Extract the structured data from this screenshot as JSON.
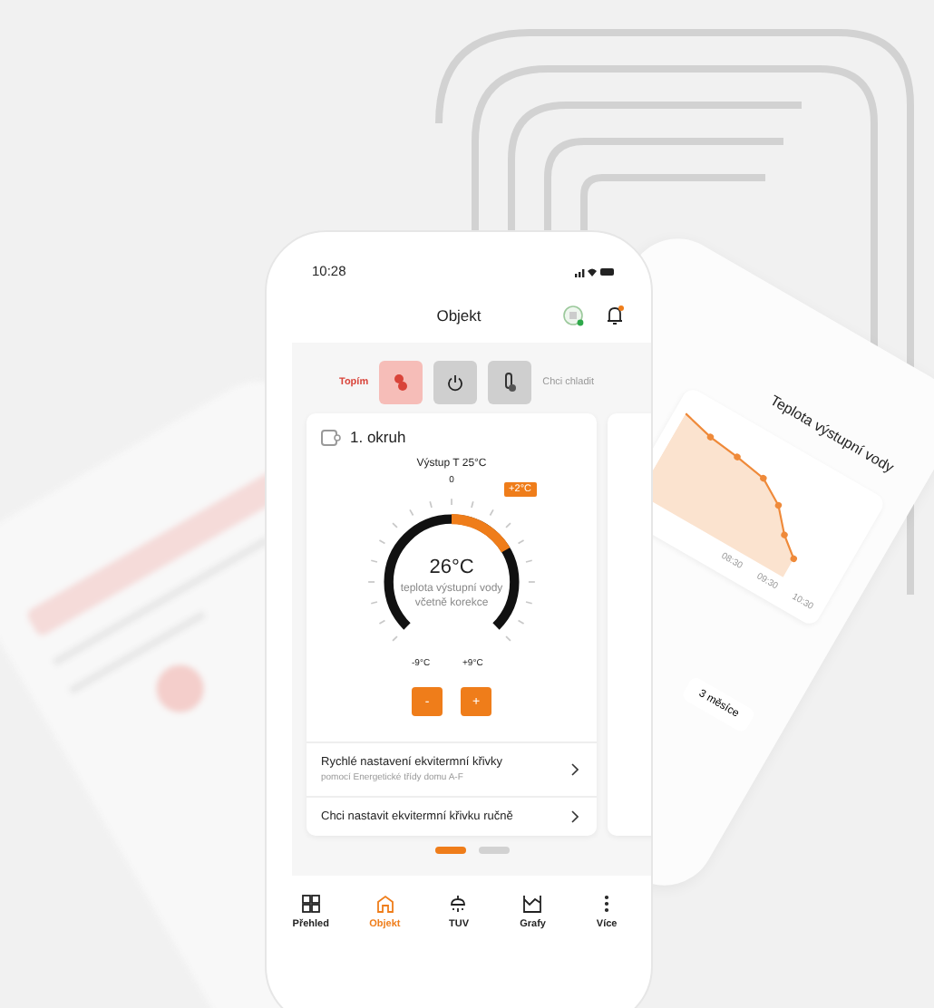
{
  "back_phone": {
    "title": "Teplota výstupní vody",
    "x_labels": [
      "08:30",
      "09:30",
      "10:30"
    ],
    "range_button": "3 měsíce"
  },
  "status_bar": {
    "time": "10:28"
  },
  "header": {
    "title": "Objekt"
  },
  "modes": {
    "left_label": "Topím",
    "right_label": "Chci chladit",
    "buttons": [
      {
        "kind": "heat",
        "selected": true
      },
      {
        "kind": "power",
        "selected": false
      },
      {
        "kind": "cool",
        "selected": false
      }
    ]
  },
  "card": {
    "title": "1. okruh",
    "output": "Výstup T 25°C",
    "dial": {
      "zero": "0",
      "correction": "+2°C",
      "value": "26°C",
      "caption": "teplota výstupní vody včetně korekce",
      "min": "-9°C",
      "max": "+9°C",
      "level": 0.72
    },
    "buttons": [
      "-",
      "+"
    ]
  },
  "links": [
    {
      "title": "Rychlé nastavení ekvitermní křivky",
      "subtitle": "pomocí Energetické třídy domu A-F"
    },
    {
      "title": "Chci nastavit ekvitermní křivku ručně"
    }
  ],
  "pager": [
    {
      "selected": true
    },
    {
      "selected": false
    }
  ],
  "tabs": [
    {
      "kind": "grid",
      "label": "Přehled",
      "selected": false
    },
    {
      "kind": "home",
      "label": "Objekt",
      "selected": true
    },
    {
      "kind": "shower",
      "label": "TUV",
      "selected": false
    },
    {
      "kind": "chart",
      "label": "Grafy",
      "selected": false
    },
    {
      "kind": "more",
      "label": "Více",
      "selected": false
    }
  ]
}
